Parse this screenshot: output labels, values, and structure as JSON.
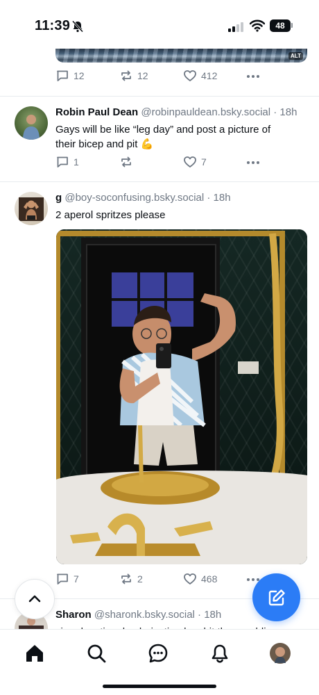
{
  "status_bar": {
    "time": "11:39",
    "battery": "48"
  },
  "top_post": {
    "image_alt_badge": "ALT",
    "replies": "12",
    "reposts": "12",
    "likes": "412"
  },
  "posts": [
    {
      "display_name": "Robin Paul Dean",
      "handle": "@robinpauldean.bsky.social",
      "time": "· 18h",
      "text_line1": "Gays will be like “leg day” and post a picture of",
      "text_line2": "their bicep and pit 💪",
      "replies": "1",
      "reposts": "",
      "likes": "7"
    },
    {
      "display_name": "g",
      "handle": "@boy-soconfusing.bsky.social",
      "time": "· 18h",
      "text_line1": "2 aperol spritzes please",
      "replies": "7",
      "reposts": "2",
      "likes": "468"
    },
    {
      "display_name": "Sharon",
      "handle": "@sharonk.bsky.social",
      "time": "· 18h",
      "text_line1": "cir, educational polarization has hit the republican"
    }
  ],
  "icons": {
    "reply": "speech-bubble-icon",
    "repost": "repost-arrows-icon",
    "like": "heart-icon",
    "more": "ellipsis-icon",
    "scroll_top": "chevron-up-icon",
    "compose": "compose-pencil-icon",
    "nav": [
      "home-icon",
      "search-icon",
      "chat-icon",
      "bell-icon",
      "profile-avatar"
    ]
  },
  "colors": {
    "accent": "#2b7cf6",
    "muted": "#6f7884",
    "text": "#0b0f14"
  }
}
